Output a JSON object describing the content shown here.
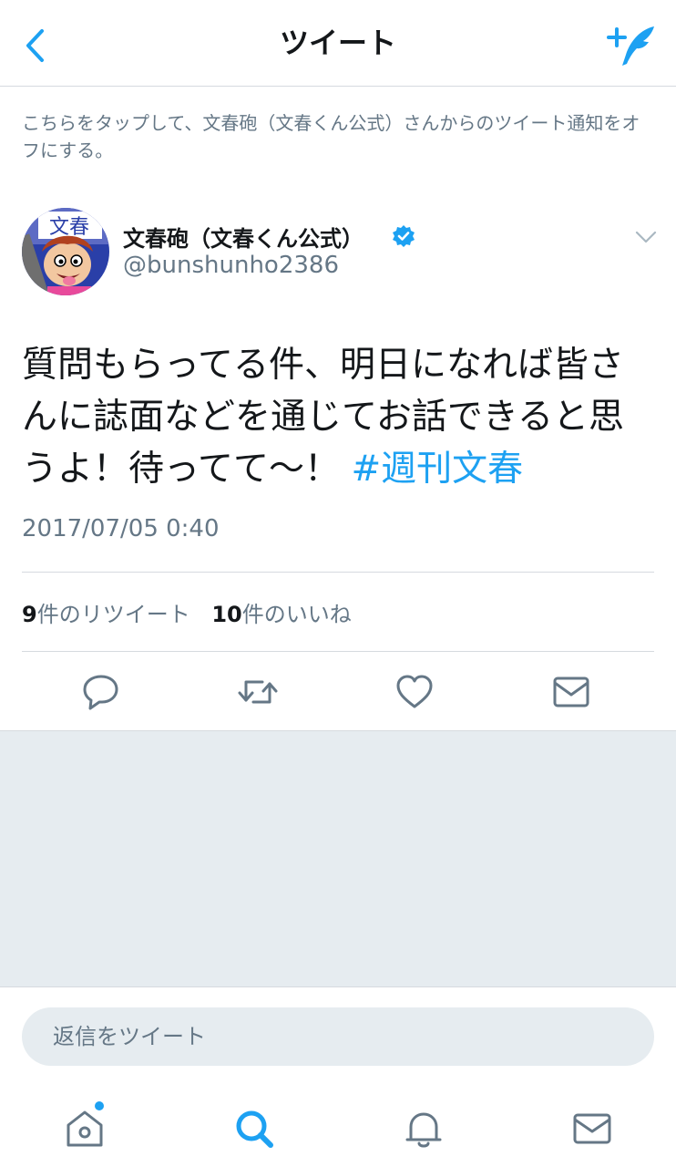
{
  "header": {
    "title": "ツイート",
    "back_icon": "chevron-left-icon",
    "compose_icon": "compose-tweet-icon"
  },
  "notice": {
    "text": "こちらをタップして、文春砲（文春くん公式）さんからのツイート通知をオフにする。"
  },
  "author": {
    "name": "文春砲（文春くん公式）",
    "handle": "@bunshunho2386",
    "verified": true,
    "avatar_text": "文春"
  },
  "tweet": {
    "text": "質問もらってる件、明日になれば皆さんに誌面などを通じてお話できると思うよ！待ってて〜！ ",
    "hashtag": "#週刊文春",
    "timestamp": "2017/07/05 0:40"
  },
  "stats": {
    "retweet_count": "9",
    "retweet_label": "件のリツイート",
    "like_count": "10",
    "like_label": "件のいいね"
  },
  "actions": [
    {
      "name": "reply",
      "icon": "reply-icon"
    },
    {
      "name": "retweet",
      "icon": "retweet-icon"
    },
    {
      "name": "like",
      "icon": "heart-icon"
    },
    {
      "name": "share",
      "icon": "envelope-icon"
    }
  ],
  "reply_box": {
    "placeholder": "返信をツイート"
  },
  "tabs": [
    {
      "name": "home",
      "icon": "home-icon",
      "has_notification_dot": true
    },
    {
      "name": "search",
      "icon": "search-icon",
      "active": true
    },
    {
      "name": "notifications",
      "icon": "bell-icon"
    },
    {
      "name": "messages",
      "icon": "envelope-icon"
    }
  ],
  "colors": {
    "accent": "#1da1f2",
    "text_primary": "#14171a",
    "text_secondary": "#657786",
    "icon_gray": "#657786",
    "background_gray": "#e6ecf0",
    "divider": "#d6dadf"
  }
}
